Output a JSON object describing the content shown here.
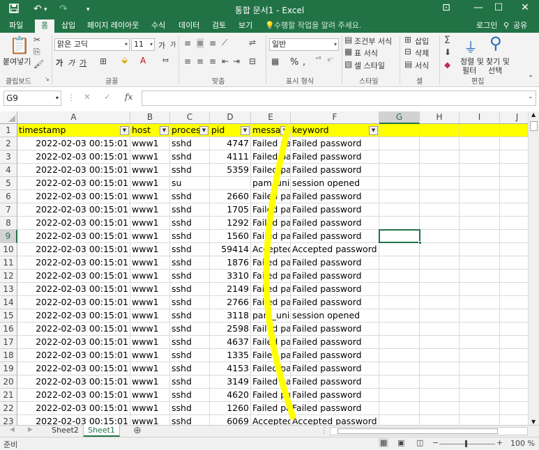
{
  "titlebar": {
    "title": "통합 문서1 - Excel",
    "save_icon": "save-icon",
    "undo_glyph": "↶",
    "redo_glyph": "↷",
    "customize_glyph": "▾",
    "window_controls": [
      "⊡",
      "—",
      "☐",
      "✕"
    ]
  },
  "tabs": {
    "items": [
      "파일",
      "홈",
      "삽입",
      "페이지 레이아웃",
      "수식",
      "데이터",
      "검토",
      "보기"
    ],
    "active": "홈",
    "tell_me": "수행할 작업을 알려 주세요.",
    "login": "로그인",
    "share": "공유"
  },
  "ribbon": {
    "clipboard": {
      "paste": "붙여넣기",
      "label": "클립보드"
    },
    "font": {
      "name": "맑은 고딕",
      "size": "11",
      "bold": "가",
      "italic": "가",
      "underline": "가",
      "grow": "가",
      "shrink": "가",
      "label": "글꼴"
    },
    "alignment": {
      "label": "맞춤"
    },
    "number": {
      "format": "일반",
      "label": "표시 형식",
      "percent": "%",
      "comma": ","
    },
    "styles": {
      "conditional": "조건부 서식",
      "table": "표 서식",
      "cell": "셀 스타일",
      "label": "스타일"
    },
    "cells": {
      "insert": "삽입",
      "delete": "삭제",
      "format": "서식",
      "label": "셀"
    },
    "editing": {
      "sort": "정렬 및",
      "sort2": "필터",
      "find": "찾기 및",
      "find2": "선택",
      "label": "편집"
    }
  },
  "formula_bar": {
    "name_box": "G9",
    "value": "",
    "fx": "fx"
  },
  "columns": [
    "A",
    "B",
    "C",
    "D",
    "E",
    "F",
    "G",
    "H",
    "I",
    "J"
  ],
  "selected_column": "G",
  "selected_row": "9",
  "header_row": [
    "timestamp",
    "host",
    "process",
    "pid",
    "message",
    "keyword"
  ],
  "rows": [
    {
      "n": "2",
      "ts": "2022-02-03 00:15:01",
      "host": "www1",
      "proc": "sshd",
      "pid": "4747",
      "msg": "Failed pas",
      "kw": "Failed password"
    },
    {
      "n": "3",
      "ts": "2022-02-03 00:15:01",
      "host": "www1",
      "proc": "sshd",
      "pid": "4111",
      "msg": "Failed pas",
      "kw": "Failed password"
    },
    {
      "n": "4",
      "ts": "2022-02-03 00:15:01",
      "host": "www1",
      "proc": "sshd",
      "pid": "5359",
      "msg": "Failed pas",
      "kw": "Failed password"
    },
    {
      "n": "5",
      "ts": "2022-02-03 00:15:01",
      "host": "www1",
      "proc": "su",
      "pid": "",
      "msg": "pam_unix",
      "kw": "session opened"
    },
    {
      "n": "6",
      "ts": "2022-02-03 00:15:01",
      "host": "www1",
      "proc": "sshd",
      "pid": "2660",
      "msg": "Failed pas",
      "kw": "Failed password"
    },
    {
      "n": "7",
      "ts": "2022-02-03 00:15:01",
      "host": "www1",
      "proc": "sshd",
      "pid": "1705",
      "msg": "Failed pas",
      "kw": "Failed password"
    },
    {
      "n": "8",
      "ts": "2022-02-03 00:15:01",
      "host": "www1",
      "proc": "sshd",
      "pid": "1292",
      "msg": "Failed pas",
      "kw": "Failed password"
    },
    {
      "n": "9",
      "ts": "2022-02-03 00:15:01",
      "host": "www1",
      "proc": "sshd",
      "pid": "1560",
      "msg": "Failed pas",
      "kw": "Failed password"
    },
    {
      "n": "10",
      "ts": "2022-02-03 00:15:01",
      "host": "www1",
      "proc": "sshd",
      "pid": "59414",
      "msg": "Accepted",
      "kw": "Accepted password"
    },
    {
      "n": "11",
      "ts": "2022-02-03 00:15:01",
      "host": "www1",
      "proc": "sshd",
      "pid": "1876",
      "msg": "Failed pas",
      "kw": "Failed password"
    },
    {
      "n": "12",
      "ts": "2022-02-03 00:15:01",
      "host": "www1",
      "proc": "sshd",
      "pid": "3310",
      "msg": "Failed pas",
      "kw": "Failed password"
    },
    {
      "n": "13",
      "ts": "2022-02-03 00:15:01",
      "host": "www1",
      "proc": "sshd",
      "pid": "2149",
      "msg": "Failed pas",
      "kw": "Failed password"
    },
    {
      "n": "14",
      "ts": "2022-02-03 00:15:01",
      "host": "www1",
      "proc": "sshd",
      "pid": "2766",
      "msg": "Failed pas",
      "kw": "Failed password"
    },
    {
      "n": "15",
      "ts": "2022-02-03 00:15:01",
      "host": "www1",
      "proc": "sshd",
      "pid": "3118",
      "msg": "pam_unix",
      "kw": "session opened"
    },
    {
      "n": "16",
      "ts": "2022-02-03 00:15:01",
      "host": "www1",
      "proc": "sshd",
      "pid": "2598",
      "msg": "Failed pas",
      "kw": "Failed password"
    },
    {
      "n": "17",
      "ts": "2022-02-03 00:15:01",
      "host": "www1",
      "proc": "sshd",
      "pid": "4637",
      "msg": "Failed pas",
      "kw": "Failed password"
    },
    {
      "n": "18",
      "ts": "2022-02-03 00:15:01",
      "host": "www1",
      "proc": "sshd",
      "pid": "1335",
      "msg": "Failed pas",
      "kw": "Failed password"
    },
    {
      "n": "19",
      "ts": "2022-02-03 00:15:01",
      "host": "www1",
      "proc": "sshd",
      "pid": "4153",
      "msg": "Failed pas",
      "kw": "Failed password"
    },
    {
      "n": "20",
      "ts": "2022-02-03 00:15:01",
      "host": "www1",
      "proc": "sshd",
      "pid": "3149",
      "msg": "Failed pas",
      "kw": "Failed password"
    },
    {
      "n": "21",
      "ts": "2022-02-03 00:15:01",
      "host": "www1",
      "proc": "sshd",
      "pid": "4620",
      "msg": "Failed pas",
      "kw": "Failed password"
    },
    {
      "n": "22",
      "ts": "2022-02-03 00:15:01",
      "host": "www1",
      "proc": "sshd",
      "pid": "1260",
      "msg": "Failed pas",
      "kw": "Failed password"
    },
    {
      "n": "23",
      "ts": "2022-02-03 00:15:01",
      "host": "www1",
      "proc": "sshd",
      "pid": "6069",
      "msg": "Accepted",
      "kw": "Accepted password"
    }
  ],
  "sheets": [
    "Sheet2",
    "Sheet1"
  ],
  "active_sheet": "Sheet1",
  "status": {
    "mode": "준비",
    "zoom": "100 %"
  },
  "colors": {
    "accent": "#217346",
    "highlight": "#ffff00"
  }
}
